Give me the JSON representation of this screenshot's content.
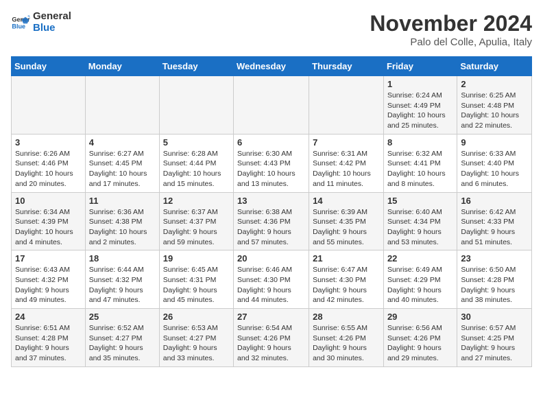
{
  "logo": {
    "line1": "General",
    "line2": "Blue"
  },
  "title": "November 2024",
  "subtitle": "Palo del Colle, Apulia, Italy",
  "days_of_week": [
    "Sunday",
    "Monday",
    "Tuesday",
    "Wednesday",
    "Thursday",
    "Friday",
    "Saturday"
  ],
  "weeks": [
    [
      {
        "day": "",
        "info": ""
      },
      {
        "day": "",
        "info": ""
      },
      {
        "day": "",
        "info": ""
      },
      {
        "day": "",
        "info": ""
      },
      {
        "day": "",
        "info": ""
      },
      {
        "day": "1",
        "info": "Sunrise: 6:24 AM\nSunset: 4:49 PM\nDaylight: 10 hours and 25 minutes."
      },
      {
        "day": "2",
        "info": "Sunrise: 6:25 AM\nSunset: 4:48 PM\nDaylight: 10 hours and 22 minutes."
      }
    ],
    [
      {
        "day": "3",
        "info": "Sunrise: 6:26 AM\nSunset: 4:46 PM\nDaylight: 10 hours and 20 minutes."
      },
      {
        "day": "4",
        "info": "Sunrise: 6:27 AM\nSunset: 4:45 PM\nDaylight: 10 hours and 17 minutes."
      },
      {
        "day": "5",
        "info": "Sunrise: 6:28 AM\nSunset: 4:44 PM\nDaylight: 10 hours and 15 minutes."
      },
      {
        "day": "6",
        "info": "Sunrise: 6:30 AM\nSunset: 4:43 PM\nDaylight: 10 hours and 13 minutes."
      },
      {
        "day": "7",
        "info": "Sunrise: 6:31 AM\nSunset: 4:42 PM\nDaylight: 10 hours and 11 minutes."
      },
      {
        "day": "8",
        "info": "Sunrise: 6:32 AM\nSunset: 4:41 PM\nDaylight: 10 hours and 8 minutes."
      },
      {
        "day": "9",
        "info": "Sunrise: 6:33 AM\nSunset: 4:40 PM\nDaylight: 10 hours and 6 minutes."
      }
    ],
    [
      {
        "day": "10",
        "info": "Sunrise: 6:34 AM\nSunset: 4:39 PM\nDaylight: 10 hours and 4 minutes."
      },
      {
        "day": "11",
        "info": "Sunrise: 6:36 AM\nSunset: 4:38 PM\nDaylight: 10 hours and 2 minutes."
      },
      {
        "day": "12",
        "info": "Sunrise: 6:37 AM\nSunset: 4:37 PM\nDaylight: 9 hours and 59 minutes."
      },
      {
        "day": "13",
        "info": "Sunrise: 6:38 AM\nSunset: 4:36 PM\nDaylight: 9 hours and 57 minutes."
      },
      {
        "day": "14",
        "info": "Sunrise: 6:39 AM\nSunset: 4:35 PM\nDaylight: 9 hours and 55 minutes."
      },
      {
        "day": "15",
        "info": "Sunrise: 6:40 AM\nSunset: 4:34 PM\nDaylight: 9 hours and 53 minutes."
      },
      {
        "day": "16",
        "info": "Sunrise: 6:42 AM\nSunset: 4:33 PM\nDaylight: 9 hours and 51 minutes."
      }
    ],
    [
      {
        "day": "17",
        "info": "Sunrise: 6:43 AM\nSunset: 4:32 PM\nDaylight: 9 hours and 49 minutes."
      },
      {
        "day": "18",
        "info": "Sunrise: 6:44 AM\nSunset: 4:32 PM\nDaylight: 9 hours and 47 minutes."
      },
      {
        "day": "19",
        "info": "Sunrise: 6:45 AM\nSunset: 4:31 PM\nDaylight: 9 hours and 45 minutes."
      },
      {
        "day": "20",
        "info": "Sunrise: 6:46 AM\nSunset: 4:30 PM\nDaylight: 9 hours and 44 minutes."
      },
      {
        "day": "21",
        "info": "Sunrise: 6:47 AM\nSunset: 4:30 PM\nDaylight: 9 hours and 42 minutes."
      },
      {
        "day": "22",
        "info": "Sunrise: 6:49 AM\nSunset: 4:29 PM\nDaylight: 9 hours and 40 minutes."
      },
      {
        "day": "23",
        "info": "Sunrise: 6:50 AM\nSunset: 4:28 PM\nDaylight: 9 hours and 38 minutes."
      }
    ],
    [
      {
        "day": "24",
        "info": "Sunrise: 6:51 AM\nSunset: 4:28 PM\nDaylight: 9 hours and 37 minutes."
      },
      {
        "day": "25",
        "info": "Sunrise: 6:52 AM\nSunset: 4:27 PM\nDaylight: 9 hours and 35 minutes."
      },
      {
        "day": "26",
        "info": "Sunrise: 6:53 AM\nSunset: 4:27 PM\nDaylight: 9 hours and 33 minutes."
      },
      {
        "day": "27",
        "info": "Sunrise: 6:54 AM\nSunset: 4:26 PM\nDaylight: 9 hours and 32 minutes."
      },
      {
        "day": "28",
        "info": "Sunrise: 6:55 AM\nSunset: 4:26 PM\nDaylight: 9 hours and 30 minutes."
      },
      {
        "day": "29",
        "info": "Sunrise: 6:56 AM\nSunset: 4:26 PM\nDaylight: 9 hours and 29 minutes."
      },
      {
        "day": "30",
        "info": "Sunrise: 6:57 AM\nSunset: 4:25 PM\nDaylight: 9 hours and 27 minutes."
      }
    ]
  ]
}
